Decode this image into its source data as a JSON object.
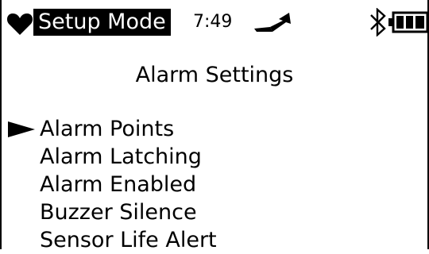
{
  "status_bar": {
    "mode": "Setup Mode",
    "time": "7:49",
    "icons": [
      "heart-icon",
      "signal-icon",
      "bluetooth-icon",
      "battery-icon"
    ],
    "battery_level": 1.0
  },
  "screen": {
    "title": "Alarm Settings",
    "selected_index": 0,
    "menu": [
      {
        "label": "Alarm Points"
      },
      {
        "label": "Alarm Latching"
      },
      {
        "label": "Alarm Enabled"
      },
      {
        "label": "Buzzer Silence"
      },
      {
        "label": "Sensor Life Alert"
      }
    ]
  },
  "colors": {
    "foreground": "#000000",
    "background": "#ffffff"
  }
}
